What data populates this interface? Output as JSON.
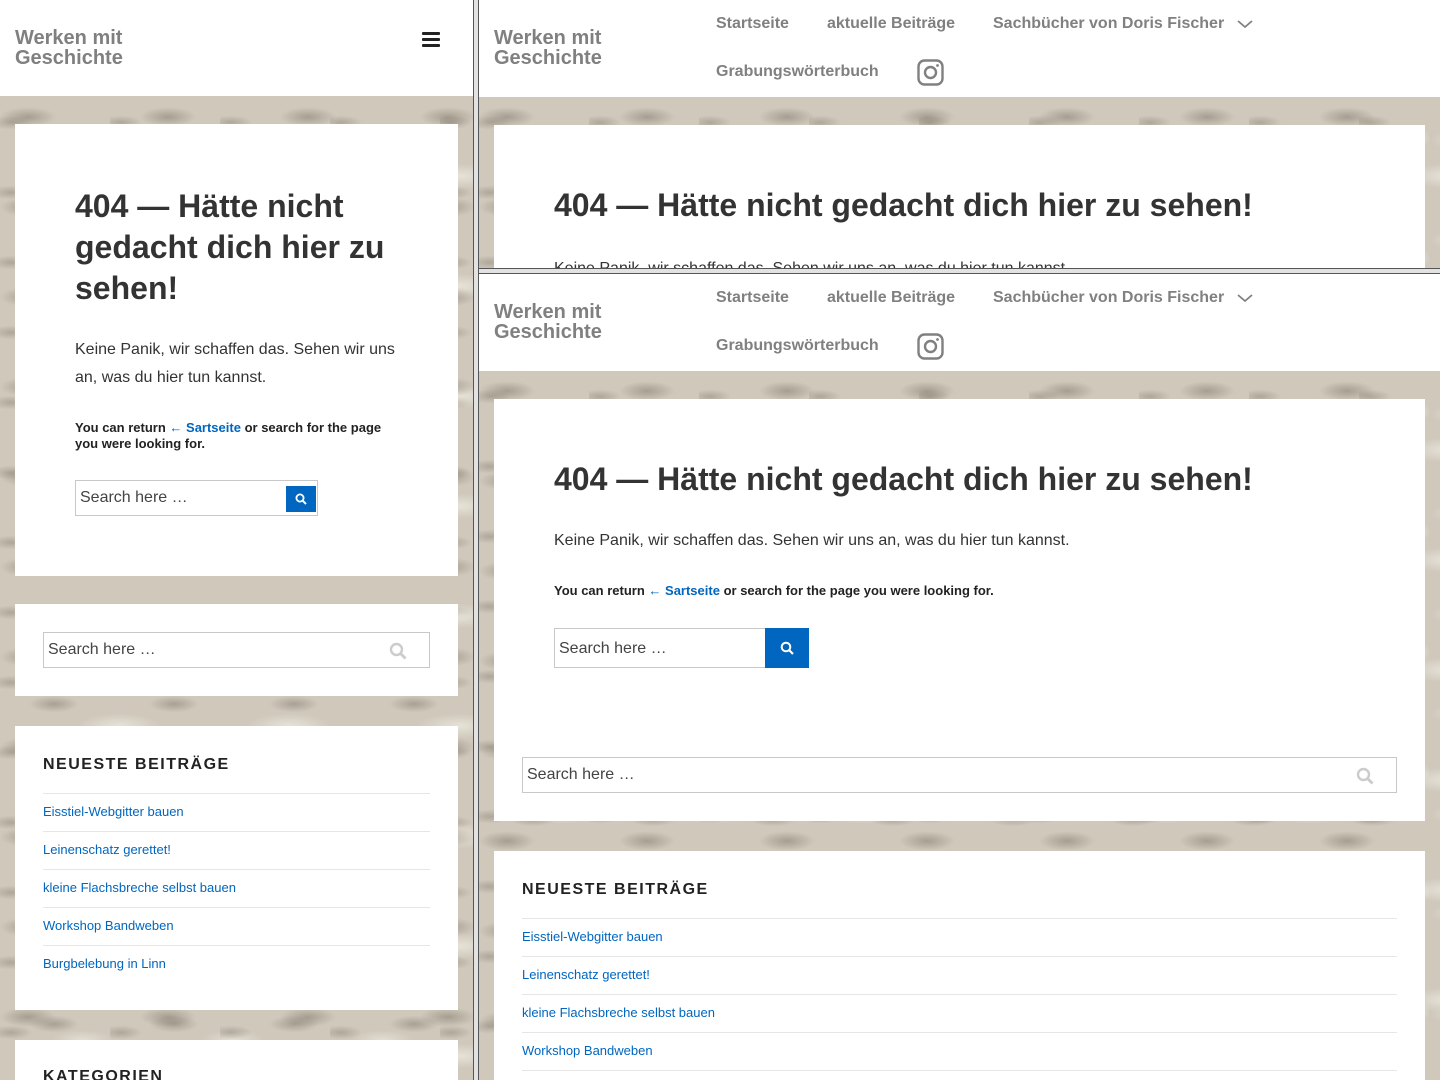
{
  "site": {
    "title": "Werken mit Geschichte"
  },
  "nav": {
    "items": [
      "Startseite",
      "aktuelle Beiträge",
      "Sachbücher von Doris Fischer",
      "Grabungswörterbuch"
    ],
    "instagram_icon": "instagram-icon",
    "menu_icon": "hamburger-menu-icon"
  },
  "error": {
    "title": "404 — Hätte nicht gedacht dich hier zu sehen!",
    "text": "Keine Panik, wir schaffen das. Sehen wir uns an, was du hier tun kannst.",
    "return_prefix": "You can return",
    "return_link": "← Sartseite",
    "return_suffix": "or search for the page you were looking for."
  },
  "search": {
    "placeholder": "Search here …"
  },
  "sidebar": {
    "recent_title": "NEUESTE BEITRÄGE",
    "posts": [
      "Eisstiel-Webgitter bauen",
      "Leinenschatz gerettet!",
      "kleine Flachsbreche selbst bauen",
      "Workshop Bandweben",
      "Burgbelebung in Linn"
    ],
    "categories_title": "KATEGORIEN"
  },
  "colors": {
    "link": "#0066bf",
    "title_gray": "#808080",
    "text": "#333333"
  }
}
